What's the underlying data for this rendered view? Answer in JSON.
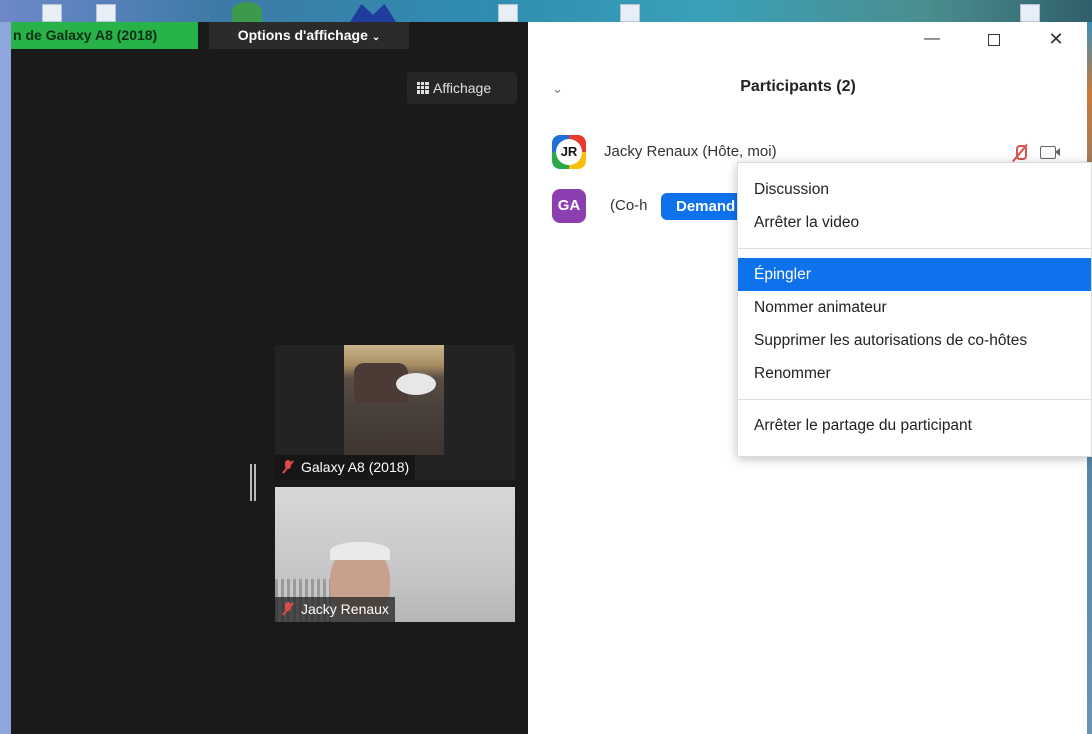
{
  "window": {
    "meeting_tab": "n de Galaxy A8 (2018)",
    "view_options": "Options d'affichage",
    "view_button": "Affichage"
  },
  "videos": [
    {
      "name": "Galaxy A8 (2018)",
      "muted": true
    },
    {
      "name": "Jacky Renaux",
      "muted": true
    }
  ],
  "participants": {
    "title": "Participants (2)",
    "list": [
      {
        "initials": "JR",
        "name": "Jacky Renaux (Hôte, moi)",
        "mic_muted": true,
        "video": "off"
      },
      {
        "initials": "GA",
        "name_fragment": "(Co-h",
        "action_button": "Demand"
      }
    ]
  },
  "context_menu": {
    "group1": [
      "Discussion",
      "Arrêter la video"
    ],
    "group2": [
      "Épingler",
      "Nommer animateur",
      "Supprimer les autorisations de co-hôtes",
      "Renommer"
    ],
    "group3": [
      "Arrêter le partage du participant"
    ],
    "highlighted": "Épingler"
  },
  "colors": {
    "accent": "#0e72ed",
    "meeting_tab": "#27b24a",
    "ga_avatar": "#8b3fb1",
    "muted_red": "#d9534f"
  }
}
